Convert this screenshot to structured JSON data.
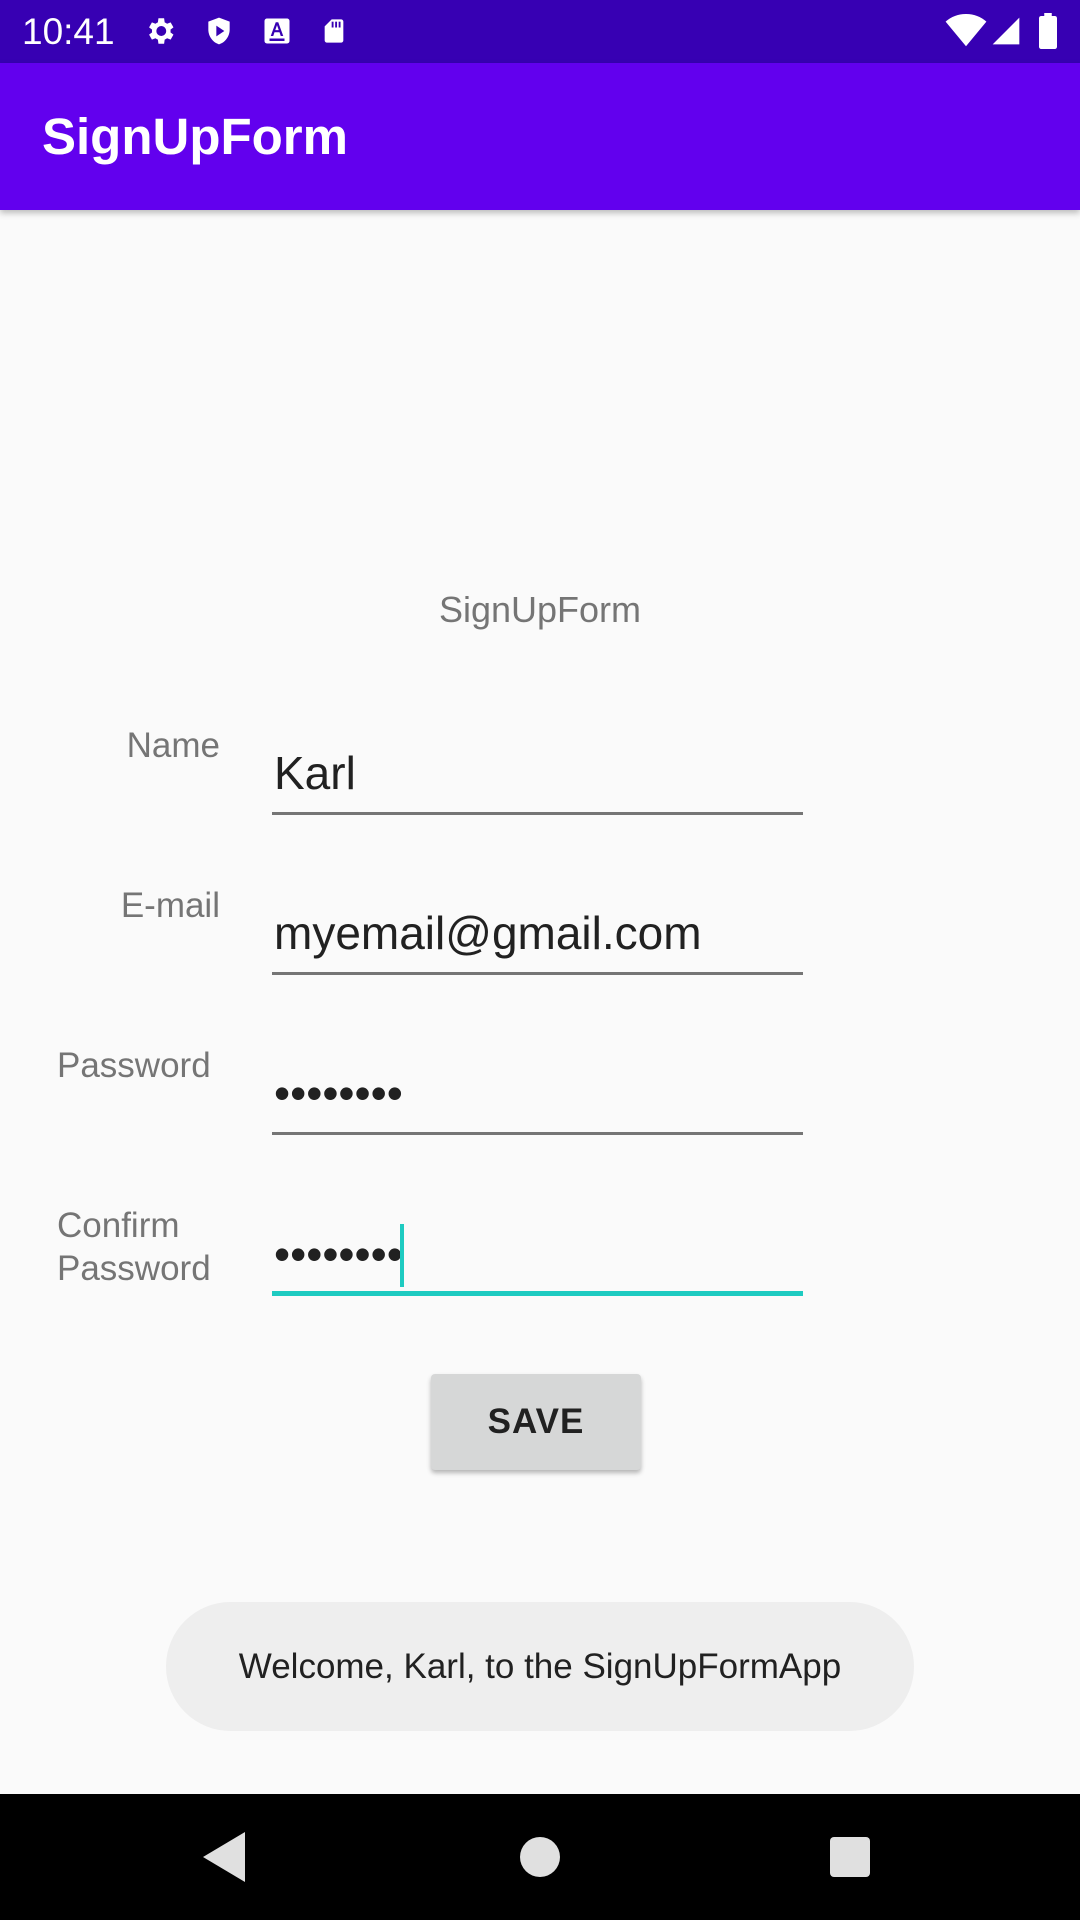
{
  "status_bar": {
    "time": "10:41",
    "left_icons": [
      "gear-icon",
      "shield-icon",
      "font-a-icon",
      "sd-card-icon"
    ],
    "right_icons": [
      "wifi-icon",
      "signal-icon",
      "battery-icon"
    ]
  },
  "app_bar": {
    "title": "SignUpForm"
  },
  "form": {
    "heading": "SignUpForm",
    "name": {
      "label": "Name",
      "value": "Karl"
    },
    "email": {
      "label": "E-mail",
      "value": "myemail@gmail.com"
    },
    "password": {
      "label": "Password",
      "value": "••••••••"
    },
    "confirm_password": {
      "label_line1": "Confirm",
      "label_line2": "Password",
      "value": "••••••••"
    },
    "save_label": "SAVE"
  },
  "toast": {
    "message": "Welcome, Karl, to the SignUpFormApp"
  },
  "nav_bar": {
    "icons": [
      "back-icon",
      "home-icon",
      "recents-icon"
    ]
  },
  "colors": {
    "status_bar": "#3700B3",
    "app_bar": "#6200EE",
    "accent": "#1ECBC1"
  }
}
